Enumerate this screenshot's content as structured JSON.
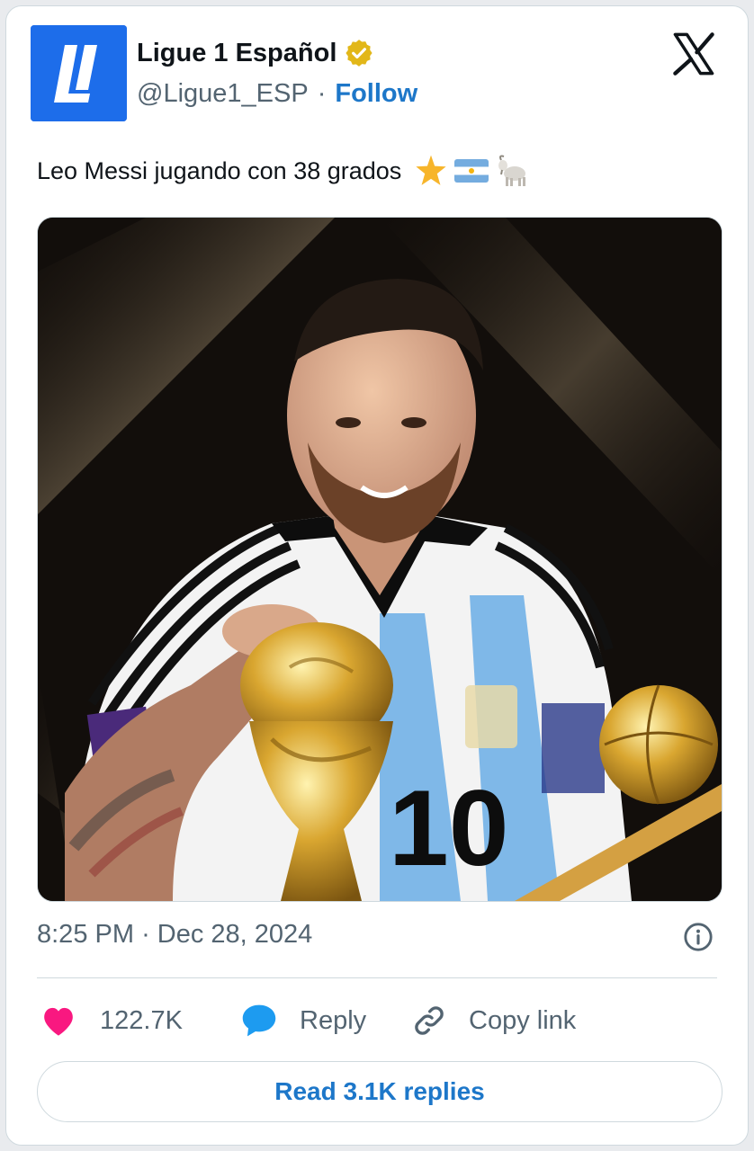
{
  "account": {
    "name": "Ligue 1 Español",
    "handle": "@Ligue1_ESP",
    "separator": "·",
    "follow_label": "Follow",
    "logo_text": "L1"
  },
  "tweet": {
    "text": "Leo Messi jugando con 38 grados",
    "emojis": [
      "star-emoji",
      "argentina-flag-emoji",
      "goat-emoji"
    ],
    "image_alt": "Messi with World Cup trophy"
  },
  "meta": {
    "time": "8:25 PM",
    "separator": "·",
    "date": "Dec 28, 2024"
  },
  "actions": {
    "likes_count": "122.7K",
    "reply_label": "Reply",
    "copy_link_label": "Copy link"
  },
  "read_replies_label": "Read 3.1K replies",
  "icons": {
    "verified": "verified-badge-icon",
    "x_logo": "x-logo-icon",
    "info": "info-icon",
    "like": "heart-icon",
    "reply": "speech-bubble-icon",
    "copy": "link-icon"
  },
  "colors": {
    "brand_blue": "#1d6dea",
    "link_blue": "#1d77c9",
    "verified_gold": "#e2b719",
    "like_pink": "#f91880",
    "reply_blue": "#1d9bf0",
    "muted_text": "#536471"
  }
}
